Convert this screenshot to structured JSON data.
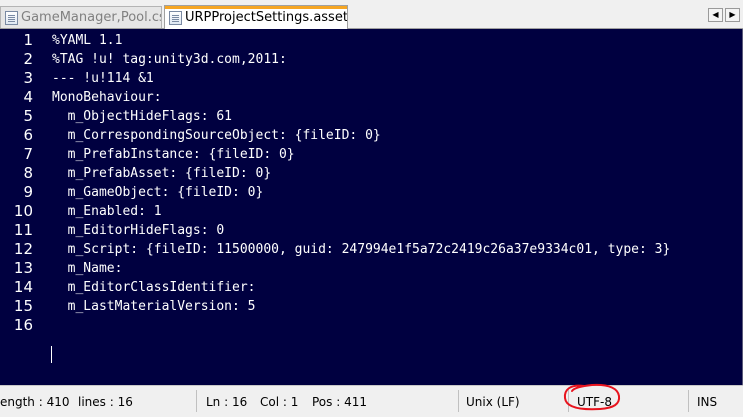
{
  "tabs": [
    {
      "label": "GameManager,Pool.cs",
      "icon": "file-icon",
      "active": false
    },
    {
      "label": "URPProjectSettings.asset",
      "icon": "file-icon",
      "active": true
    }
  ],
  "nav": {
    "prev": "◀",
    "next": "▶"
  },
  "editor": {
    "background": "#000040",
    "lines": [
      {
        "n": "1",
        "text": "%YAML 1.1"
      },
      {
        "n": "2",
        "text": "%TAG !u! tag:unity3d.com,2011:"
      },
      {
        "n": "3",
        "text": "--- !u!114 &1"
      },
      {
        "n": "4",
        "text": "MonoBehaviour:"
      },
      {
        "n": "5",
        "text": "  m_ObjectHideFlags: 61"
      },
      {
        "n": "6",
        "text": "  m_CorrespondingSourceObject: {fileID: 0}"
      },
      {
        "n": "7",
        "text": "  m_PrefabInstance: {fileID: 0}"
      },
      {
        "n": "8",
        "text": "  m_PrefabAsset: {fileID: 0}"
      },
      {
        "n": "9",
        "text": "  m_GameObject: {fileID: 0}"
      },
      {
        "n": "10",
        "text": "  m_Enabled: 1"
      },
      {
        "n": "11",
        "text": "  m_EditorHideFlags: 0"
      },
      {
        "n": "12",
        "text": "  m_Script: {fileID: 11500000, guid: 247994e1f5a72c2419c26a37e9334c01, type: 3}"
      },
      {
        "n": "13",
        "text": "  m_Name:"
      },
      {
        "n": "14",
        "text": "  m_EditorClassIdentifier:"
      },
      {
        "n": "15",
        "text": "  m_LastMaterialVersion: 5"
      },
      {
        "n": "16",
        "text": ""
      }
    ]
  },
  "status": {
    "length": "ength : 410",
    "lines": "lines : 16",
    "ln": "Ln : 16",
    "col": "Col : 1",
    "pos": "Pos : 411",
    "eol": "Unix (LF)",
    "encoding": "UTF-8",
    "mode": "INS",
    "highlight_color": "#e8141e"
  }
}
